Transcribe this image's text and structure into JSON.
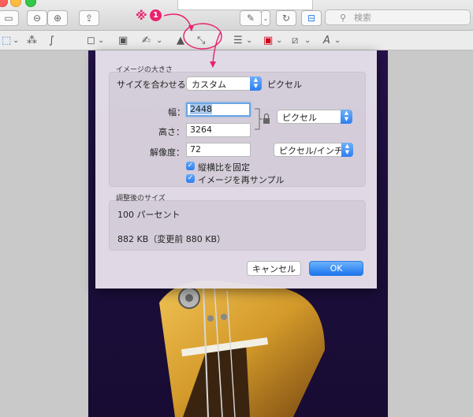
{
  "toolbar": {
    "search_placeholder": "検索"
  },
  "annotation": {
    "mark": "※",
    "number": "1"
  },
  "dialog": {
    "section1_title": "イメージの大きさ",
    "fit_label": "サイズを合わせる：",
    "fit_value": "カスタム",
    "fit_unit": "ピクセル",
    "width_label": "幅：",
    "width_value": "2448",
    "height_label": "高さ：",
    "height_value": "3264",
    "dim_unit": "ピクセル",
    "resolution_label": "解像度：",
    "resolution_value": "72",
    "resolution_unit": "ピクセル/インチ",
    "keep_ratio_label": "縦横比を固定",
    "resample_label": "イメージを再サンプル",
    "section2_title": "調整後のサイズ",
    "percent": "100 パーセント",
    "filesize": "882 KB（変更前 880 KB）",
    "cancel_label": "キャンセル",
    "ok_label": "OK"
  },
  "colors": {
    "accent": "#2f7ef0",
    "annotation": "#e8226e"
  }
}
